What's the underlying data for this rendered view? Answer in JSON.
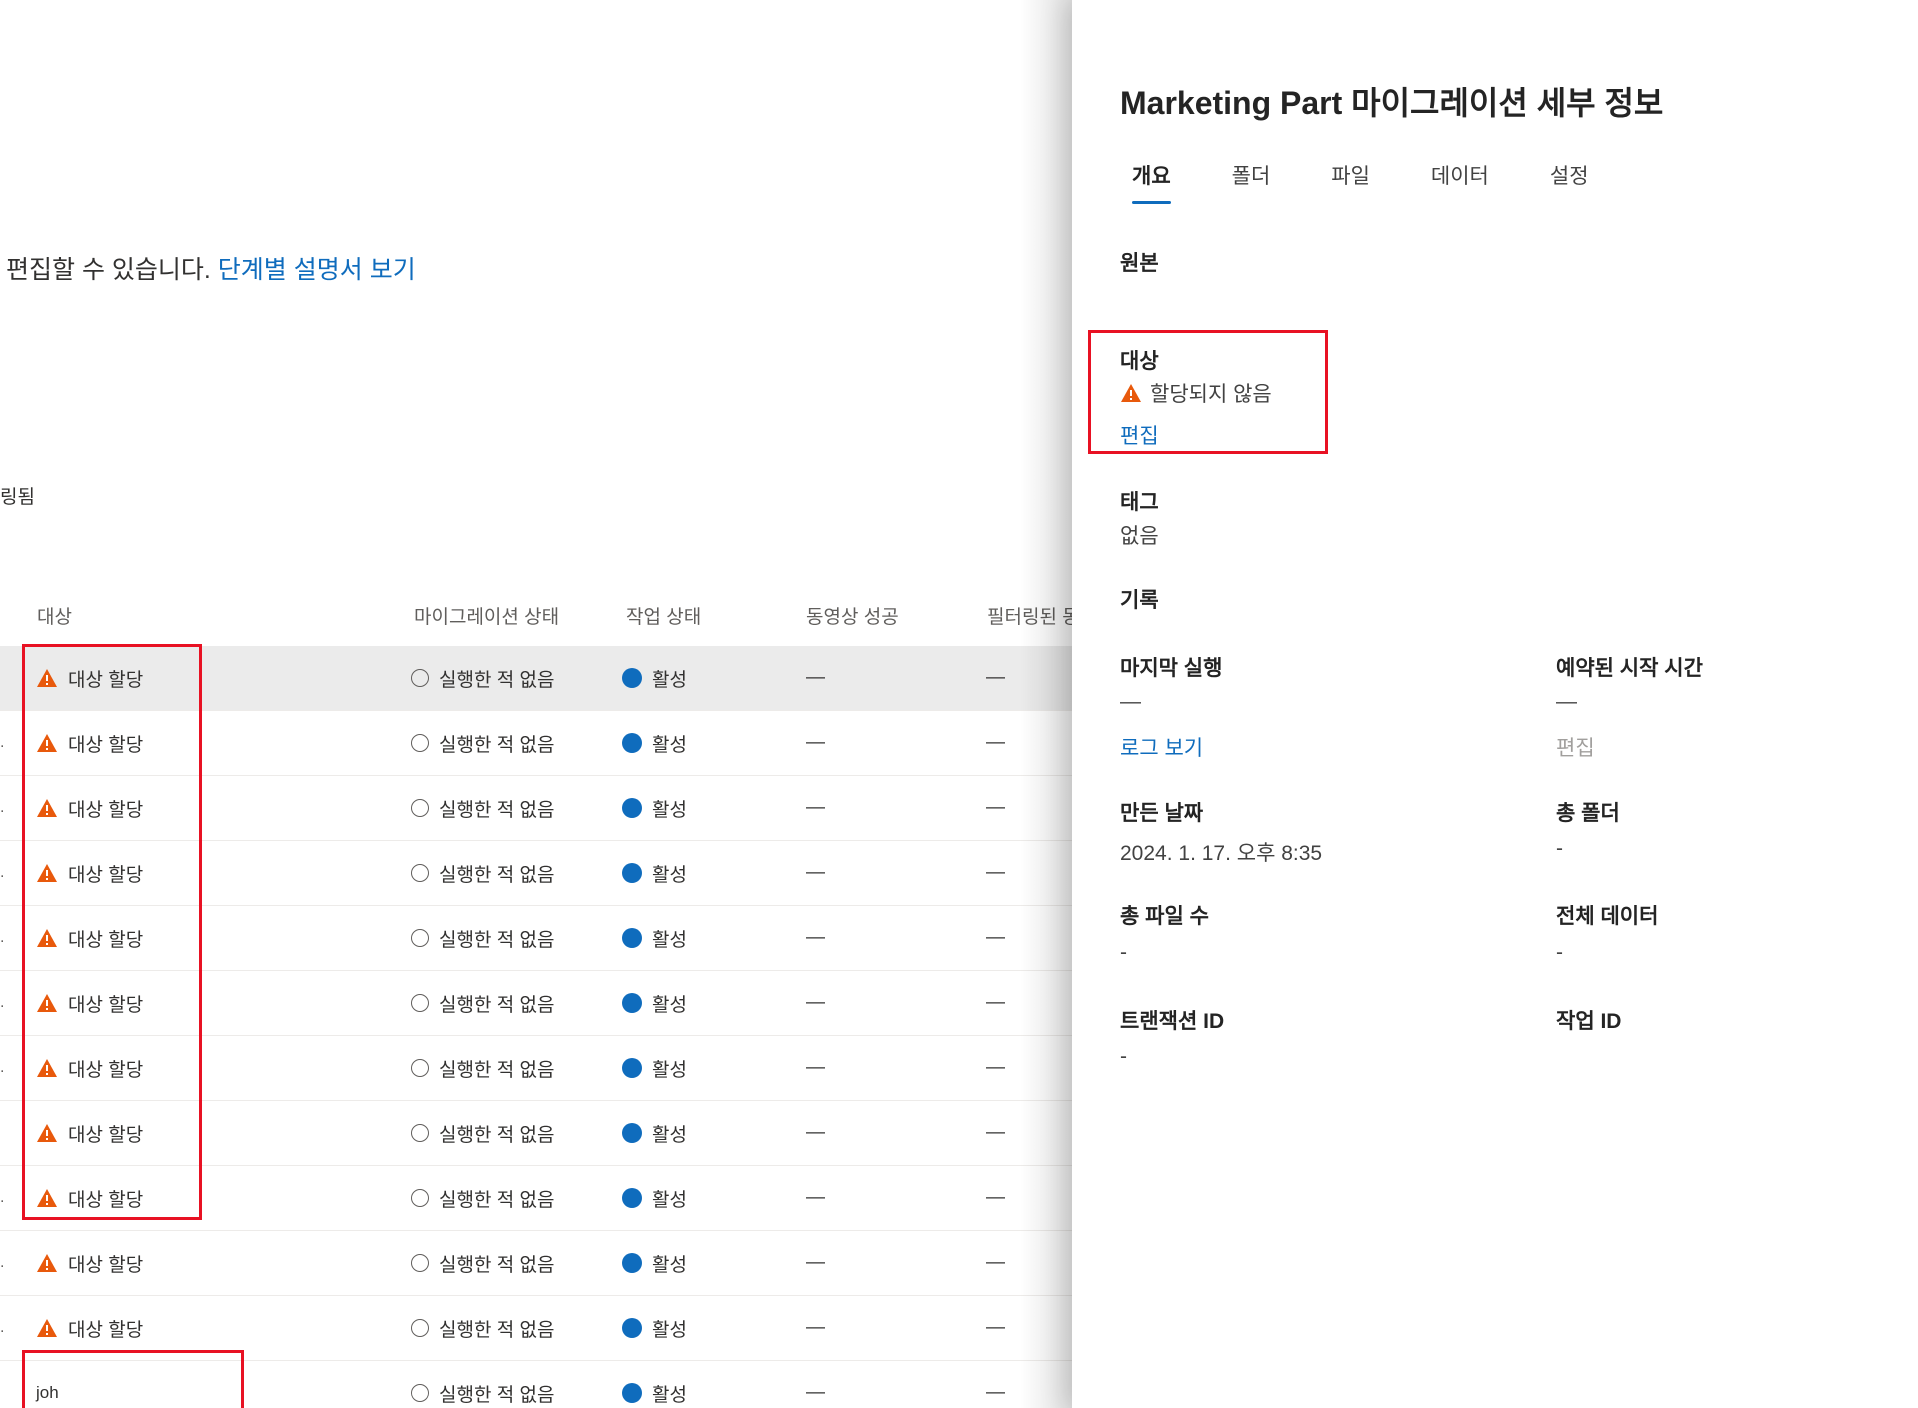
{
  "intro": {
    "text": "편집할 수 있습니다.",
    "link": "단계별 설명서 보기"
  },
  "filter_note": "링됨",
  "table": {
    "headers": [
      "대상",
      "마이그레이션 상태",
      "작업 상태",
      "동영상 성공",
      "필터링된 동"
    ],
    "rows": [
      {
        "lead": "",
        "target": "대상 할당",
        "migration": "실행한 적 없음",
        "job": "활성",
        "video": "—",
        "filtered": "—"
      },
      {
        "lead": ".",
        "target": "대상 할당",
        "migration": "실행한 적 없음",
        "job": "활성",
        "video": "—",
        "filtered": "—"
      },
      {
        "lead": ".",
        "target": "대상 할당",
        "migration": "실행한 적 없음",
        "job": "활성",
        "video": "—",
        "filtered": "—"
      },
      {
        "lead": ".",
        "target": "대상 할당",
        "migration": "실행한 적 없음",
        "job": "활성",
        "video": "—",
        "filtered": "—"
      },
      {
        "lead": ".",
        "target": "대상 할당",
        "migration": "실행한 적 없음",
        "job": "활성",
        "video": "—",
        "filtered": "—"
      },
      {
        "lead": ".",
        "target": "대상 할당",
        "migration": "실행한 적 없음",
        "job": "활성",
        "video": "—",
        "filtered": "—"
      },
      {
        "lead": ".",
        "target": "대상 할당",
        "migration": "실행한 적 없음",
        "job": "활성",
        "video": "—",
        "filtered": "—"
      },
      {
        "lead": "",
        "target": "대상 할당",
        "migration": "실행한 적 없음",
        "job": "활성",
        "video": "—",
        "filtered": "—"
      },
      {
        "lead": ".",
        "target": "대상 할당",
        "migration": "실행한 적 없음",
        "job": "활성",
        "video": "—",
        "filtered": "—"
      },
      {
        "lead": ".",
        "target": "대상 할당",
        "migration": "실행한 적 없음",
        "job": "활성",
        "video": "—",
        "filtered": "—"
      },
      {
        "lead": ".",
        "target": "대상 할당",
        "migration": "실행한 적 없음",
        "job": "활성",
        "video": "—",
        "filtered": "—"
      }
    ],
    "last_row": {
      "target_input": "joh",
      "migration": "실행한 적 없음",
      "job": "활성",
      "video": "—",
      "filtered": "—"
    }
  },
  "panel": {
    "title": "Marketing Part 마이그레이션 세부 정보",
    "tabs": [
      "개요",
      "폴더",
      "파일",
      "데이터",
      "설정"
    ],
    "active_tab": "개요",
    "source_label": "원본",
    "target_label": "대상",
    "target_value": "할당되지 않음",
    "target_edit": "편집",
    "tags_label": "태그",
    "tags_value": "없음",
    "history_label": "기록",
    "last_run_label": "마지막 실행",
    "last_run_value": "—",
    "view_log": "로그 보기",
    "scheduled_label": "예약된 시작 시간",
    "scheduled_value": "—",
    "scheduled_edit": "편집",
    "created_label": "만든 날짜",
    "created_value": "2024. 1. 17. 오후 8:35",
    "total_folders_label": "총 폴더",
    "total_folders_value": "-",
    "total_files_label": "총 파일 수",
    "total_files_value": "-",
    "total_data_label": "전체 데이터",
    "total_data_value": "-",
    "transaction_id_label": "트랜잭션 ID",
    "transaction_id_value": "-",
    "job_id_label": "작업 ID"
  },
  "colors": {
    "accent": "#0f6cbd",
    "warning": "#e8590c",
    "highlight": "#e81123"
  }
}
